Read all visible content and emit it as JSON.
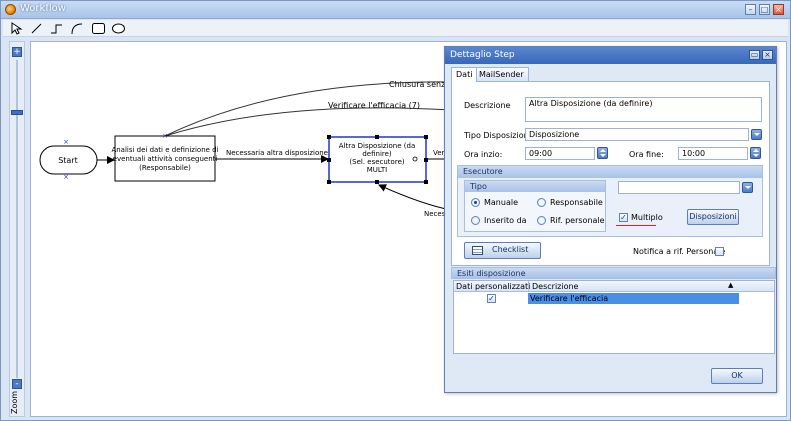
{
  "window": {
    "title": "Workflow"
  },
  "toolbar": {
    "tools": [
      "pointer-tool",
      "line-tool",
      "step-line-tool",
      "arc-tool",
      "rectangle-tool",
      "ellipse-tool"
    ]
  },
  "zoom": {
    "label": "Zoom",
    "plus": "+",
    "minus": "-",
    "level": 0.2
  },
  "diagram": {
    "start": "Start",
    "node1": [
      "Analisi dei dati e definizione di",
      "eventuali attività conseguenti",
      "(Responsabile)"
    ],
    "node2": [
      "Altra Disposizione (da",
      "definire)",
      "(Sel. esecutore)",
      "MULTI"
    ],
    "edge_main": "Necessaria altra disposizione",
    "edge_top1": "Chiusura senza alt",
    "edge_top2": "Verificare l'efficacia (7)",
    "edge_right": "Verif",
    "edge_bottom": "Necess"
  },
  "dialog": {
    "title": "Dettaglio Step",
    "tabs": [
      "Dati",
      "MailSender"
    ],
    "descrizione_label": "Descrizione",
    "descrizione_value": "Altra Disposizione (da definire)",
    "tipo_disp_label": "Tipo Disposizione",
    "tipo_disp_value": "Disposizione",
    "ora_inizio_label": "Ora inzio:",
    "ora_inizio_value": "09:00",
    "ora_fine_label": "Ora fine:",
    "ora_fine_value": "10:00",
    "esecutore_label": "Esecutore",
    "tipo_label": "Tipo",
    "radio_manuale": "Manuale",
    "radio_responsabile": "Responsabile",
    "radio_inserito": "Inserito da",
    "radio_rif": "Rif. personale",
    "selected_radio": "Manuale",
    "multiplo_label": "Multiplo",
    "multiplo_checked": true,
    "disposizioni_button": "Disposizioni",
    "checklist_button": "Checklist",
    "notifica_label": "Notifica a rif. Personale",
    "esiti_label": "Esiti disposizione",
    "grid_headers": [
      "Dati personalizzati",
      "Descrizione"
    ],
    "grid_rows": [
      {
        "dati": true,
        "descrizione": "Verificare l'efficacia"
      }
    ],
    "ok_button": "OK"
  },
  "colors": {
    "accent": "#3868b9",
    "selected_row": "#4a8fe7",
    "node_border_selected": "#2233cc"
  }
}
